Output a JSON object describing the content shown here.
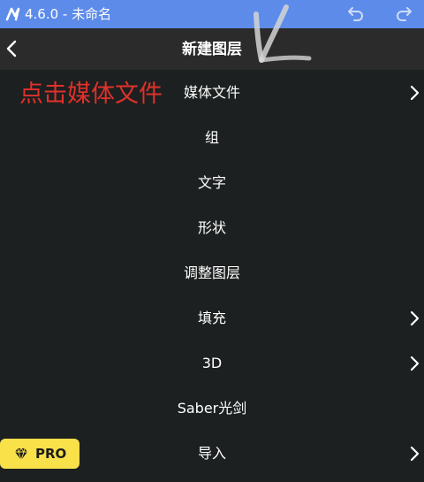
{
  "app": {
    "version_title": "4.6.0 - 未命名"
  },
  "header": {
    "title": "新建图层"
  },
  "annotation": {
    "text": "点击媒体文件"
  },
  "menu": {
    "items": [
      {
        "label": "媒体文件",
        "has_submenu": true
      },
      {
        "label": "组",
        "has_submenu": false
      },
      {
        "label": "文字",
        "has_submenu": false
      },
      {
        "label": "形状",
        "has_submenu": false
      },
      {
        "label": "调整图层",
        "has_submenu": false
      },
      {
        "label": "填充",
        "has_submenu": true
      },
      {
        "label": "3D",
        "has_submenu": true
      },
      {
        "label": "Saber光剑",
        "has_submenu": false
      },
      {
        "label": "导入",
        "has_submenu": true
      }
    ]
  },
  "pro_badge": {
    "label": "PRO"
  },
  "colors": {
    "topbar": "#5c8bea",
    "background": "#1d2020",
    "header": "#2b2b2b",
    "annotation": "#e0312a",
    "pro": "#f9e14a"
  },
  "icons": {
    "logo": "app-logo-icon",
    "undo": "undo-icon",
    "redo": "redo-icon",
    "back": "back-chevron-icon",
    "submenu": "chevron-right-icon",
    "pro": "diamond-icon"
  }
}
